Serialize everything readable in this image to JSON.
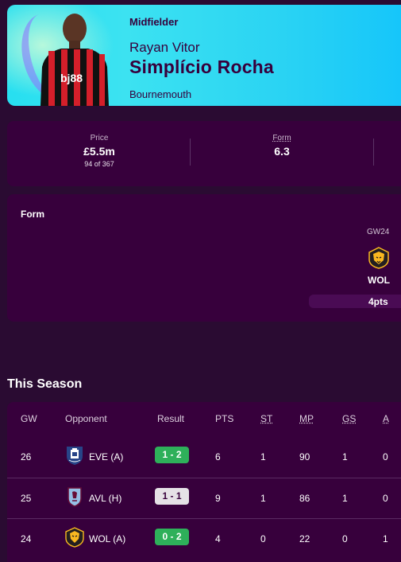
{
  "player": {
    "position": "Midfielder",
    "first_name": "Rayan Vitor",
    "last_name": "Simplício Rocha",
    "club": "Bournemouth",
    "shirt_sponsor": "bj88"
  },
  "stats": {
    "price_label": "Price",
    "price_value": "£5.5m",
    "price_rank": "94 of 367",
    "form_label": "Form",
    "form_value": "6.3"
  },
  "form_panel": {
    "title": "Form",
    "gameweek": "GW24",
    "opponent": "WOL",
    "points": "4pts"
  },
  "season": {
    "title": "This Season",
    "headers": {
      "gw": "GW",
      "opponent": "Opponent",
      "result": "Result",
      "pts": "PTS",
      "st": "ST",
      "mp": "MP",
      "gs": "GS",
      "a": "A"
    },
    "rows": [
      {
        "gw": "26",
        "opponent": "EVE (A)",
        "badge": "everton-badge",
        "result": "1 - 2",
        "outcome": "win",
        "pts": "6",
        "st": "1",
        "mp": "90",
        "gs": "1",
        "a": "0"
      },
      {
        "gw": "25",
        "opponent": "AVL (H)",
        "badge": "aston-villa-badge",
        "result": "1 - 1",
        "outcome": "draw",
        "pts": "9",
        "st": "1",
        "mp": "86",
        "gs": "1",
        "a": "0"
      },
      {
        "gw": "24",
        "opponent": "WOL (A)",
        "badge": "wolves-badge",
        "result": "0 - 2",
        "outcome": "win",
        "pts": "4",
        "st": "0",
        "mp": "22",
        "gs": "0",
        "a": "1"
      }
    ]
  },
  "colors": {
    "background": "#2a0b32",
    "panel": "#37003c",
    "hero_accent": "#27dff0",
    "win": "#2eb05a",
    "draw": "#e5e1e6"
  }
}
